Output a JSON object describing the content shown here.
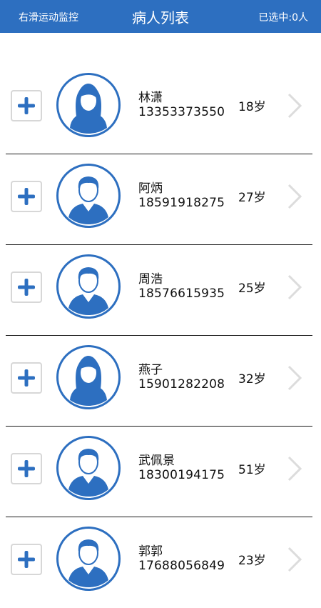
{
  "header": {
    "left_action": "右滑运动监控",
    "title": "病人列表",
    "selected_status": "已选中:0人"
  },
  "patients": [
    {
      "name": "林潇",
      "phone": "13353373550",
      "age": "18岁",
      "gender": "female"
    },
    {
      "name": "阿炳",
      "phone": "18591918275",
      "age": "27岁",
      "gender": "male"
    },
    {
      "name": "周浩",
      "phone": "18576615935",
      "age": "25岁",
      "gender": "male"
    },
    {
      "name": "燕子",
      "phone": "15901282208",
      "age": "32岁",
      "gender": "female"
    },
    {
      "name": "武佩景",
      "phone": "18300194175",
      "age": "51岁",
      "gender": "male"
    },
    {
      "name": "郭郭",
      "phone": "17688056849",
      "age": "23岁",
      "gender": "male"
    }
  ],
  "colors": {
    "brand": "#2d6fc0",
    "chevron": "#dcdcdc",
    "add_border": "#d7d7d7"
  }
}
